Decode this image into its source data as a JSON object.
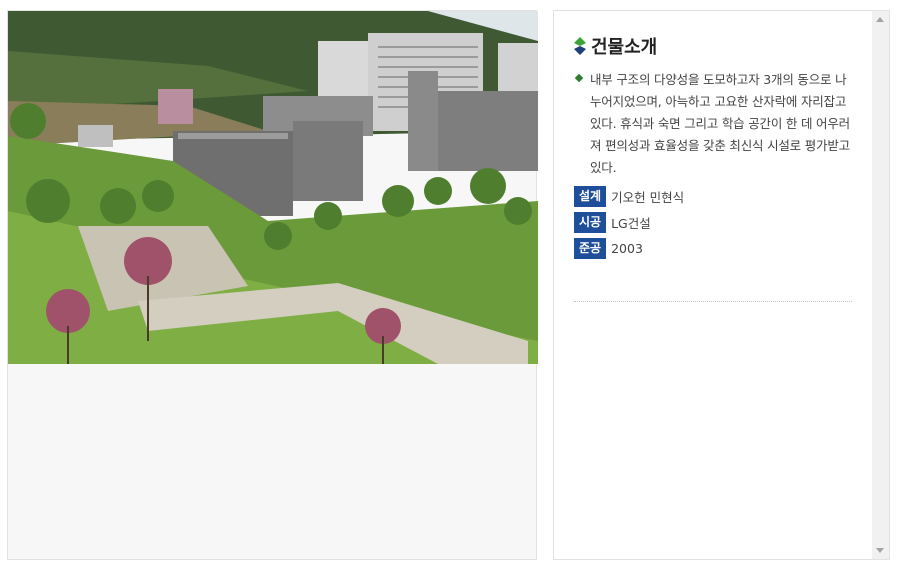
{
  "photo": {
    "alt": "건물 전경 사진"
  },
  "info": {
    "title": "건물소개",
    "description": "내부 구조의 다양성을 도모하고자 3개의 동으로 나누어지었으며, 아늑하고 고요한 산자락에 자리잡고 있다. 휴식과 숙면 그리고 학습 공간이 한 데 어우러져 편의성과 효율성을 갖춘 최신식 시설로 평가받고 있다.",
    "meta": [
      {
        "label": "설계",
        "value": "기오헌 민현식"
      },
      {
        "label": "시공",
        "value": "LG건설"
      },
      {
        "label": "준공",
        "value": "2003"
      }
    ]
  },
  "colors": {
    "label_bg": "#1f4f9a",
    "bullet": "#2e7d32",
    "icon_green": "#3aa33a",
    "icon_navy": "#1f3f7a"
  },
  "icons": [
    "diamond-title-icon",
    "diamond-bullet-icon",
    "scroll-up-arrow-icon",
    "scroll-down-arrow-icon"
  ]
}
